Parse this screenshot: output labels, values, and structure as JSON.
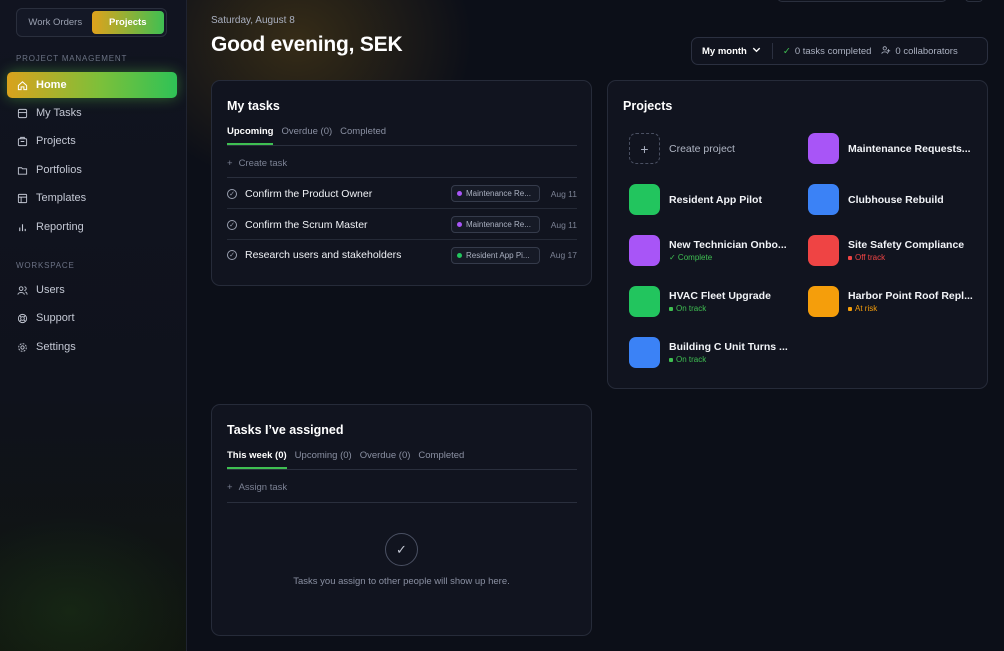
{
  "switcher": {
    "left": "Work Orders",
    "right": "Projects"
  },
  "sidebar": {
    "section1": "PROJECT MANAGEMENT",
    "items": [
      {
        "label": "Home",
        "icon": "home-icon"
      },
      {
        "label": "My Tasks",
        "icon": "tasks-icon"
      },
      {
        "label": "Projects",
        "icon": "projects-icon"
      },
      {
        "label": "Portfolios",
        "icon": "folder-icon"
      },
      {
        "label": "Templates",
        "icon": "template-icon"
      },
      {
        "label": "Reporting",
        "icon": "chart-icon"
      }
    ],
    "section2": "WORKSPACE",
    "workspace": [
      {
        "label": "Users",
        "icon": "users-icon"
      },
      {
        "label": "Support",
        "icon": "support-icon"
      },
      {
        "label": "Settings",
        "icon": "gear-icon"
      }
    ]
  },
  "header": {
    "date": "Saturday, August 8",
    "greeting": "Good evening, SEK",
    "period": "My month",
    "tasks_completed": "0 tasks completed",
    "collaborators": "0 collaborators"
  },
  "my_tasks": {
    "title": "My tasks",
    "tabs": [
      "Upcoming",
      "Overdue (0)",
      "Completed"
    ],
    "create_label": "Create task",
    "tasks": [
      {
        "name": "Confirm the Product Owner",
        "tag": "Maintenance Re...",
        "tag_color": "#a855f7",
        "due": "Aug 11"
      },
      {
        "name": "Confirm the Scrum Master",
        "tag": "Maintenance Re...",
        "tag_color": "#a855f7",
        "due": "Aug 11"
      },
      {
        "name": "Research users and stakeholders",
        "tag": "Resident App Pi...",
        "tag_color": "#22c55e",
        "due": "Aug 17"
      }
    ]
  },
  "projects": {
    "title": "Projects",
    "create_label": "Create project",
    "items": [
      {
        "name": "Maintenance Requests...",
        "color": "#a855f7",
        "status": "",
        "status_color": ""
      },
      {
        "name": "Resident App Pilot",
        "color": "#22c55e",
        "status": "",
        "status_color": ""
      },
      {
        "name": "Clubhouse Rebuild",
        "color": "#3b82f6",
        "status": "",
        "status_color": ""
      },
      {
        "name": "New Technician Onbo...",
        "color": "#a855f7",
        "status": "✓ Complete",
        "status_color": "#3fbf52"
      },
      {
        "name": "Site Safety Compliance",
        "color": "#ef4444",
        "status": "Off track",
        "status_color": "#ef4444"
      },
      {
        "name": "HVAC Fleet Upgrade",
        "color": "#22c55e",
        "status": "On track",
        "status_color": "#3fbf52"
      },
      {
        "name": "Harbor Point Roof Repl...",
        "color": "#f59e0b",
        "status": "At risk",
        "status_color": "#f59e0b"
      },
      {
        "name": "Building C Unit Turns ...",
        "color": "#3b82f6",
        "status": "On track",
        "status_color": "#3fbf52"
      }
    ]
  },
  "assigned": {
    "title": "Tasks I’ve assigned",
    "tabs": [
      "This week (0)",
      "Upcoming (0)",
      "Overdue (0)",
      "Completed"
    ],
    "assign_label": "Assign task",
    "empty_text": "Tasks you assign to other people will show up here."
  },
  "colors": {
    "accent_gold": "#e0a21c",
    "accent_green": "#3fbf52"
  }
}
